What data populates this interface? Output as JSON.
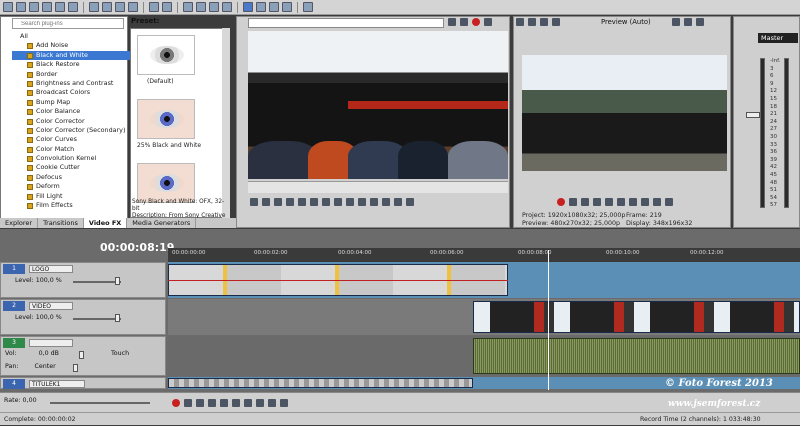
{
  "explorer": {
    "search_placeholder": "Search plug-ins",
    "root": "All",
    "items": [
      "Add Noise",
      "Black and White",
      "Black Restore",
      "Border",
      "Brightness and Contrast",
      "Broadcast Colors",
      "Bump Map",
      "Color Balance",
      "Color Corrector",
      "Color Corrector (Secondary)",
      "Color Curves",
      "Color Match",
      "Convolution Kernel",
      "Cookie Cutter",
      "Defocus",
      "Deform",
      "Fill Light",
      "Film Effects"
    ],
    "selected_index": 1
  },
  "preset": {
    "label": "Preset:",
    "items": [
      "(Default)",
      "25% Black and White",
      ""
    ],
    "description_line1": "Sony Black and White: OFX, 32-bit",
    "description_line2": "Description: From Sony Creative Sc"
  },
  "tabs": [
    "Explorer",
    "Transitions",
    "Video FX",
    "Media Generators"
  ],
  "active_tab": "Video FX",
  "preview": {
    "label": "Preview (Auto)",
    "project_key": "Project:",
    "project_val": "1920x1080x32; 25,000p",
    "preview_key": "Preview:",
    "preview_val": "480x270x32; 25,000p",
    "frame_key": "Frame:",
    "frame_val": "219",
    "display_key": "Display:",
    "display_val": "348x196x32"
  },
  "master": {
    "title": "Master",
    "db_labels": [
      "-Inf.",
      "3",
      "6",
      "9",
      "12",
      "15",
      "18",
      "21",
      "24",
      "27",
      "30",
      "33",
      "36",
      "39",
      "42",
      "45",
      "48",
      "51",
      "54",
      "57"
    ]
  },
  "timeline": {
    "timecode": "00:00:08:19",
    "ruler": [
      "00:00:00:00",
      "00:00:02:00",
      "00:00:04:00",
      "00:00:06:00",
      "00:00:08:00",
      "00:00:10:00",
      "00:00:12:00"
    ],
    "tracks": [
      {
        "num": "1",
        "name": "LOGO",
        "level": "Level: 100,0 %"
      },
      {
        "num": "2",
        "name": "VIDEO",
        "level": "Level: 100,0 %"
      },
      {
        "num": "3",
        "name": "",
        "vol": "Vol:",
        "vol_val": "0,0 dB",
        "pan": "Pan:",
        "pan_val": "Center",
        "mode": "Touch"
      },
      {
        "num": "4",
        "name": "TITULEK1"
      }
    ],
    "rate": "Rate: 0,00"
  },
  "status": {
    "left": "Complete: 00:00:00:02",
    "right": "Record Time (2 channels): 1 033:48:30"
  },
  "watermark": {
    "line1": "© Foto Forest 2013",
    "line2": "www.jsemforest.cz"
  },
  "colors": {
    "accent": "#3a78d2",
    "record": "#c82020",
    "track_video": "#3c65b0",
    "track_audio": "#2f8a4a"
  }
}
